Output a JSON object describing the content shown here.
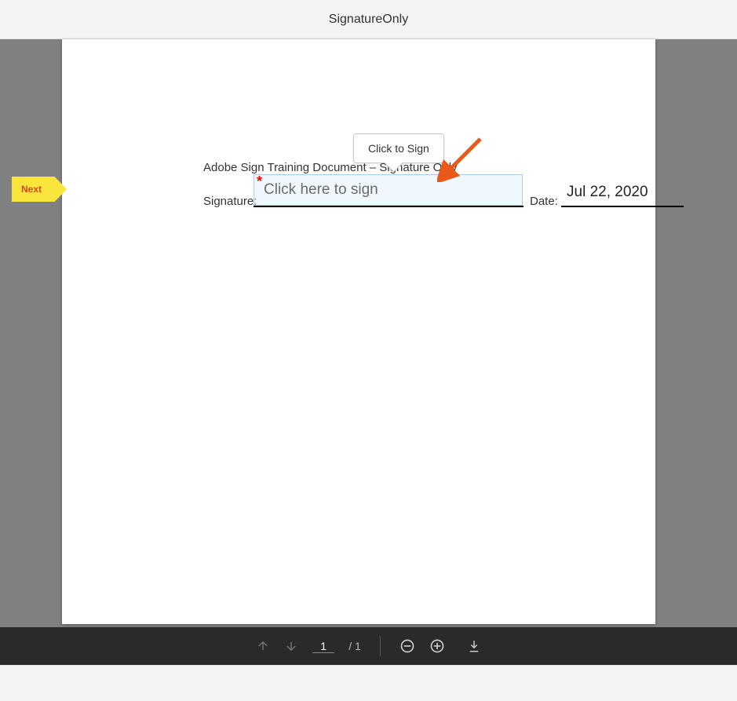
{
  "header": {
    "title": "SignatureOnly"
  },
  "flag": {
    "label": "Next"
  },
  "document": {
    "title": "Adobe Sign Training Document – Signature Only",
    "signature_label": "Signature:",
    "signature_placeholder": "Click here to sign",
    "required_mark": "*",
    "date_label": "Date:",
    "date_value": "Jul 22, 2020"
  },
  "tooltip": {
    "text": "Click to Sign"
  },
  "toolbar": {
    "current_page": "1",
    "total_pages_label": "/  1",
    "icons": {
      "prev": "arrow-up-icon",
      "next": "arrow-down-icon",
      "zoom_out": "zoom-out-icon",
      "zoom_in": "zoom-in-icon",
      "download": "download-icon"
    }
  },
  "colors": {
    "flag_bg": "#f9e53b",
    "flag_text": "#d8471a",
    "field_border": "#a7cef0",
    "annotation": "#e8591a"
  }
}
